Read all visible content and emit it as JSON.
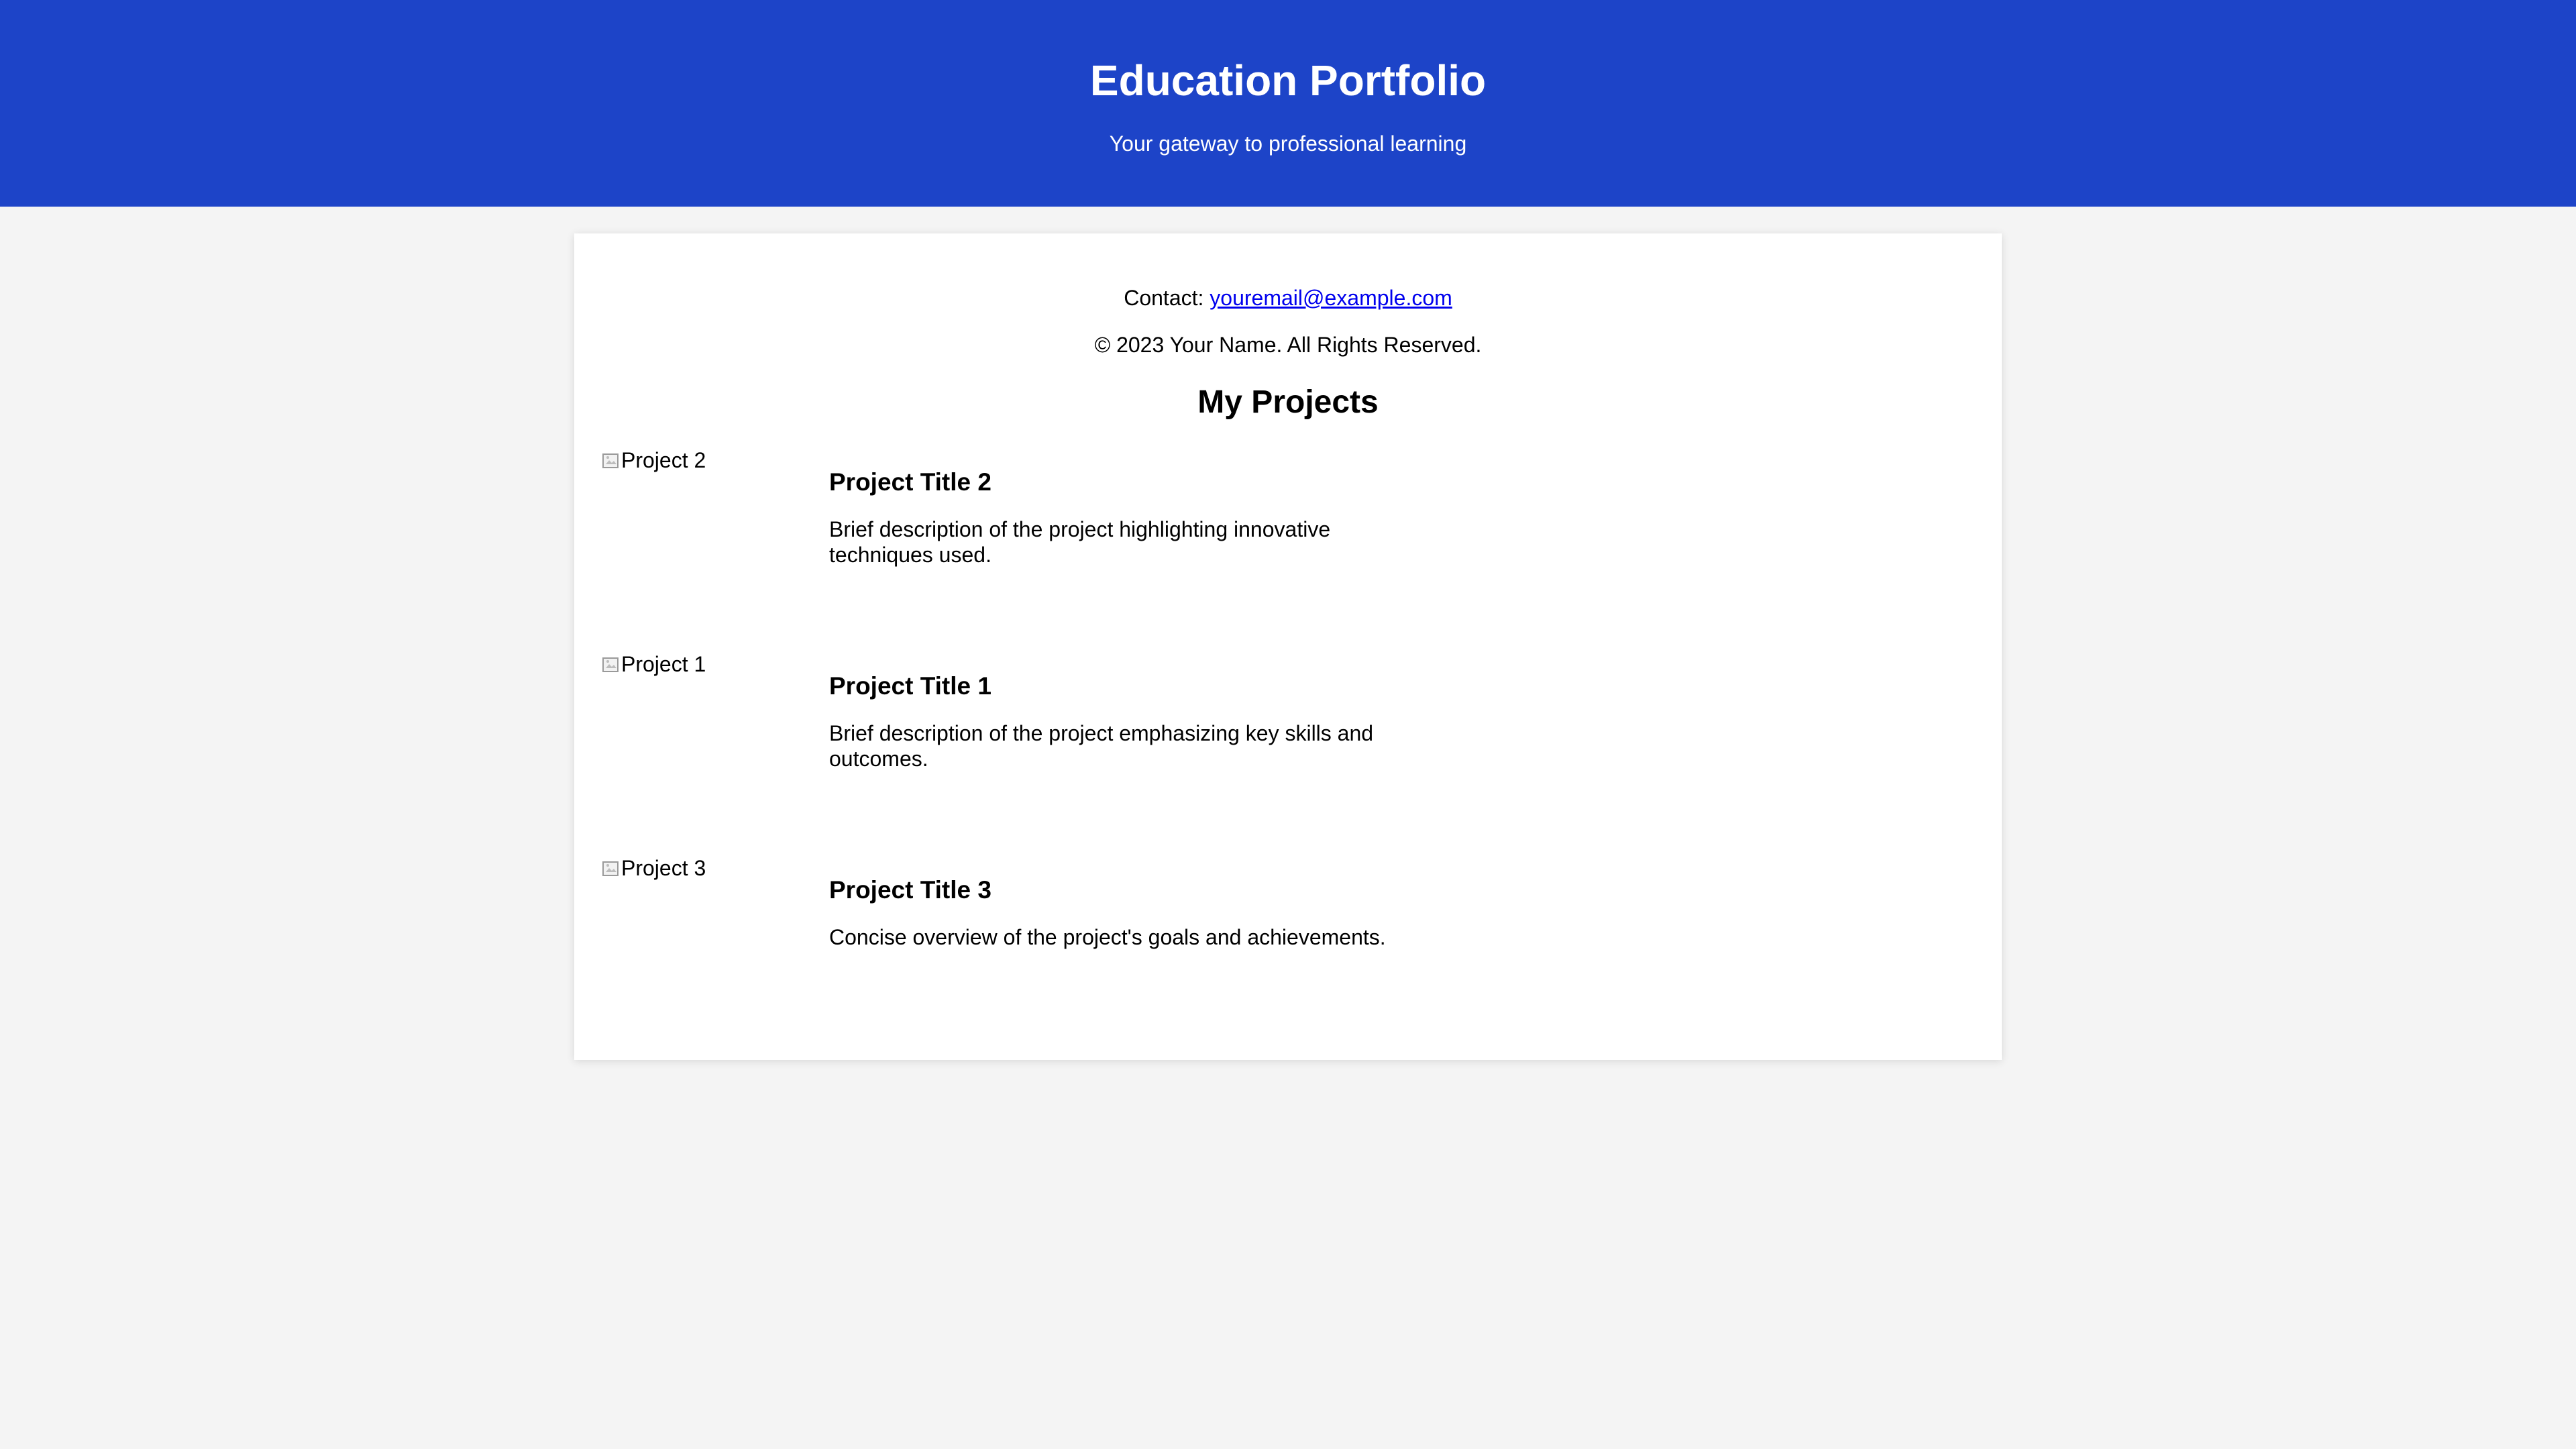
{
  "header": {
    "title": "Education Portfolio",
    "subtitle": "Your gateway to professional learning"
  },
  "contact": {
    "label": "Contact: ",
    "email": "youremail@example.com"
  },
  "copyright": "© 2023 Your Name. All Rights Reserved.",
  "projects_section": {
    "title": "My Projects",
    "items": [
      {
        "image_alt": "Project 2",
        "title": "Project Title 2",
        "description": "Brief description of the project highlighting innovative techniques used."
      },
      {
        "image_alt": "Project 1",
        "title": "Project Title 1",
        "description": "Brief description of the project emphasizing key skills and outcomes."
      },
      {
        "image_alt": "Project 3",
        "title": "Project Title 3",
        "description": "Concise overview of the project's goals and achievements."
      }
    ]
  },
  "colors": {
    "header_background": "#1d44c8",
    "page_background": "#f4f4f4",
    "link": "#0000ee"
  },
  "icons": {
    "project_image": "broken-image-icon"
  }
}
